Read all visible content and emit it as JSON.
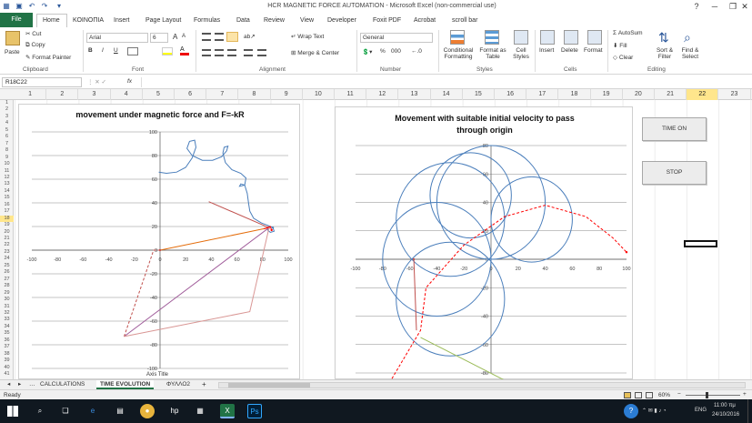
{
  "window": {
    "title": "HCR MAGNETIC FORCE AUTOMATION - Microsoft Excel (non-commercial use)",
    "minimize": "─",
    "restore": "❐",
    "close": "✕",
    "help": "?",
    "account": "a"
  },
  "ribbon_tabs": {
    "file": "File",
    "items": [
      "Home",
      "ΚΟΙΝΟΠΙΑ",
      "Insert",
      "Page Layout",
      "Formulas",
      "Data",
      "Review",
      "View",
      "Developer",
      "Foxit PDF",
      "Acrobat",
      "scroll bar"
    ]
  },
  "ribbon": {
    "clipboard": {
      "paste": "Paste",
      "cut": "Cut",
      "copy": "Copy",
      "format_painter": "Format Painter",
      "group": "Clipboard"
    },
    "font": {
      "name": "Arial",
      "size": "6",
      "bold": "B",
      "italic": "I",
      "underline": "U",
      "grow": "A",
      "shrink": "A",
      "group": "Font"
    },
    "alignment": {
      "wrap": "Wrap Text",
      "merge": "Merge & Center",
      "group": "Alignment"
    },
    "number": {
      "format": "General",
      "percent": "%",
      "comma": "000",
      "group": "Number"
    },
    "styles": {
      "conditional": "Conditional Formatting",
      "table": "Format as Table",
      "cell": "Cell Styles",
      "group": "Styles"
    },
    "cells": {
      "insert": "Insert",
      "delete": "Delete",
      "format": "Format",
      "group": "Cells"
    },
    "editing": {
      "autosum": "AutoSum",
      "fill": "Fill",
      "clear": "Clear",
      "sort": "Sort & Filter",
      "find": "Find & Select",
      "group": "Editing"
    }
  },
  "formula_bar": {
    "name_box": "R18C22",
    "fx": "fx",
    "value": ""
  },
  "columns": [
    "1",
    "2",
    "3",
    "4",
    "5",
    "6",
    "7",
    "8",
    "9",
    "10",
    "11",
    "12",
    "13",
    "14",
    "15",
    "16",
    "17",
    "18",
    "19",
    "20",
    "21",
    "22",
    "23"
  ],
  "selected_column": "22",
  "rows": [
    "1",
    "2",
    "3",
    "4",
    "5",
    "6",
    "7",
    "8",
    "9",
    "10",
    "11",
    "12",
    "13",
    "14",
    "15",
    "16",
    "17",
    "18",
    "19",
    "20",
    "21",
    "22",
    "23",
    "24",
    "25",
    "26",
    "27",
    "28",
    "29",
    "30",
    "31",
    "32",
    "33",
    "34",
    "35",
    "36",
    "37",
    "38",
    "39",
    "40",
    "41"
  ],
  "selected_row": "18",
  "sheet_buttons": {
    "time_on": "TIME ON",
    "stop": "STOP"
  },
  "sheet_tabs": {
    "tabs": [
      "CALCULATIONS",
      "TIME EVOLUTION",
      "ΦΥΛΛΟ2"
    ],
    "active": 1,
    "add": "+"
  },
  "status": {
    "mode": "Ready",
    "zoom": "60%",
    "zoom_minus": "−",
    "zoom_plus": "+"
  },
  "taskbar": {
    "time": "11:00 πμ",
    "date": "24/10/2016",
    "lang": "ENG"
  },
  "chart_data": [
    {
      "type": "scatter",
      "title": "movement under magnetic force and F=-kR",
      "axis_label": "Axis Title",
      "xlim": [
        -100,
        100
      ],
      "ylim": [
        -100,
        100
      ],
      "x_ticks": [
        "-100",
        "-80",
        "-60",
        "-40",
        "-20",
        "0",
        "20",
        "40",
        "60",
        "80",
        "100"
      ],
      "y_ticks": [
        "100",
        "80",
        "60",
        "40",
        "20",
        "0",
        "-20",
        "-40",
        "-60",
        "-80",
        "-100"
      ],
      "grid": "horizontal",
      "series": [
        {
          "color": "#4a7ebb",
          "points": [
            [
              -1,
              66
            ],
            [
              5,
              65
            ],
            [
              13,
              66
            ],
            [
              20,
              70
            ],
            [
              25,
              78
            ],
            [
              28,
              87
            ],
            [
              27,
              93
            ],
            [
              23,
              92
            ],
            [
              21,
              86
            ],
            [
              25,
              80
            ],
            [
              33,
              76
            ],
            [
              41,
              76
            ],
            [
              48,
              79
            ],
            [
              52,
              84
            ],
            [
              53,
              88
            ],
            [
              50,
              87
            ],
            [
              49,
              82
            ],
            [
              51,
              74
            ],
            [
              56,
              68
            ],
            [
              63,
              65
            ],
            [
              67,
              61
            ],
            [
              66,
              55
            ],
            [
              62,
              54
            ],
            [
              63,
              56
            ],
            [
              66,
              55
            ],
            [
              68,
              48
            ],
            [
              69,
              40
            ],
            [
              70,
              33
            ],
            [
              73,
              27
            ],
            [
              79,
              23
            ],
            [
              84,
              21
            ],
            [
              88,
              19
            ],
            [
              89,
              16
            ],
            [
              86,
              15
            ],
            [
              84,
              17
            ],
            [
              86,
              20
            ],
            [
              88,
              19
            ]
          ]
        },
        {
          "color": "#c0504d",
          "points": [
            [
              38,
              41
            ],
            [
              85,
              19
            ]
          ]
        },
        {
          "color": "#e46c0a",
          "points": [
            [
              0,
              0
            ],
            [
              85,
              19
            ]
          ]
        },
        {
          "color": "#a05c9a",
          "points": [
            [
              -28,
              -73
            ],
            [
              85,
              19
            ]
          ]
        },
        {
          "color": "#c0504d",
          "dashed": true,
          "points": [
            [
              -28,
              -73
            ],
            [
              -5,
              0
            ],
            [
              0,
              0
            ]
          ]
        },
        {
          "color": "#d99694",
          "points": [
            [
              -28,
              -73
            ],
            [
              70,
              -52
            ],
            [
              85,
              19
            ]
          ]
        },
        {
          "color": "#ff0000",
          "points": [
            [
              81,
              18
            ],
            [
              86,
              20
            ],
            [
              87,
              17
            ]
          ]
        }
      ]
    },
    {
      "type": "scatter",
      "title": "Movement with suitable initial velocity to pass through origin",
      "xlim": [
        -100,
        100
      ],
      "ylim": [
        -80,
        80
      ],
      "x_ticks": [
        "-100",
        "-80",
        "-60",
        "-40",
        "-20",
        "0",
        "20",
        "40",
        "60",
        "80",
        "100"
      ],
      "y_ticks": [
        "80",
        "60",
        "40",
        "20",
        "0",
        "-20",
        "-40",
        "-60",
        "-80"
      ],
      "grid": "horizontal",
      "series": [
        {
          "color": "#4a7ebb",
          "circles": [
            [
              0,
              40,
              40
            ],
            [
              -30,
              28,
              40
            ],
            [
              -40,
              0,
              40
            ],
            [
              -30,
              -28,
              40
            ],
            [
              30,
              28,
              30
            ],
            [
              -15,
              45,
              30
            ]
          ]
        },
        {
          "color": "#ff0000",
          "dashed": true,
          "points": [
            [
              -80,
              -95
            ],
            [
              -52,
              -50
            ],
            [
              -48,
              -20
            ],
            [
              -20,
              10
            ],
            [
              10,
              30
            ],
            [
              40,
              38
            ],
            [
              70,
              30
            ],
            [
              90,
              15
            ],
            [
              100,
              5
            ]
          ]
        },
        {
          "color": "#c0504d",
          "points": [
            [
              -55,
              -50
            ],
            [
              -57,
              0
            ]
          ]
        },
        {
          "color": "#9bbb59",
          "points": [
            [
              -52,
              -55
            ],
            [
              20,
              -90
            ]
          ]
        }
      ]
    }
  ]
}
